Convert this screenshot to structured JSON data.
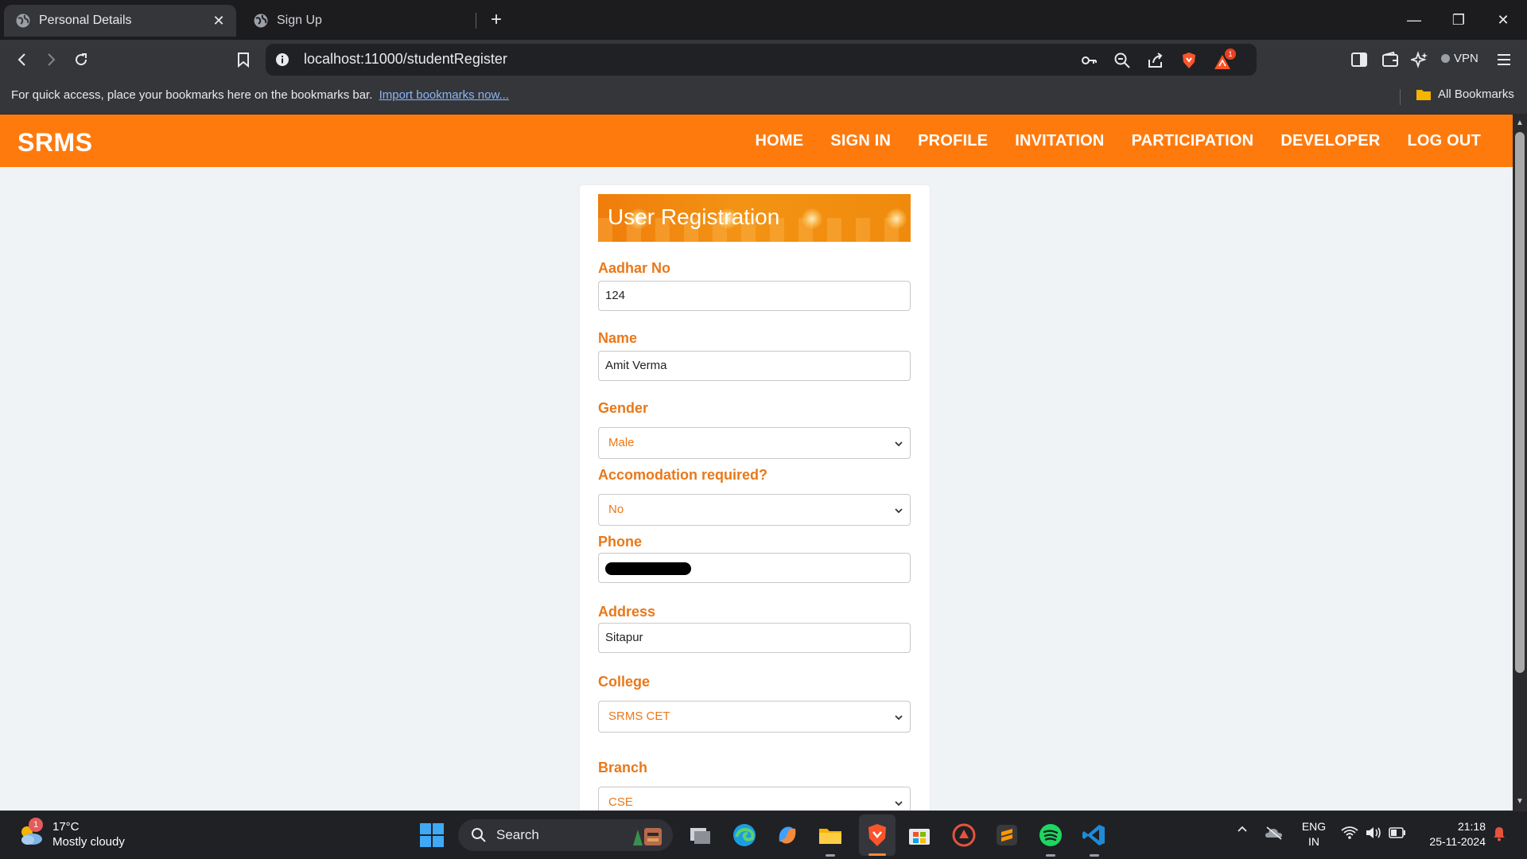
{
  "browser": {
    "tabs": [
      {
        "title": "Personal Details",
        "active": true
      },
      {
        "title": "Sign Up",
        "active": false
      }
    ],
    "url": "localhost:11000/studentRegister",
    "vpn_label": "VPN",
    "notification_count": "1",
    "bookmarks_bar": {
      "message": "For quick access, place your bookmarks here on the bookmarks bar.",
      "import_link": "Import bookmarks now...",
      "all_bookmarks": "All Bookmarks"
    }
  },
  "site": {
    "brand": "SRMS",
    "nav": [
      "HOME",
      "SIGN IN",
      "PROFILE",
      "INVITATION",
      "PARTICIPATION",
      "DEVELOPER",
      "LOG OUT"
    ],
    "accent_color": "#ff7a0d",
    "label_color": "#e9781a"
  },
  "form": {
    "title": "User Registration",
    "aadhar_label": "Aadhar No",
    "aadhar_value": "124",
    "name_label": "Name",
    "name_value": "Amit Verma",
    "gender_label": "Gender",
    "gender_value": "Male",
    "accommodation_label": "Accomodation required?",
    "accommodation_value": "No",
    "phone_label": "Phone",
    "address_label": "Address",
    "address_value": "Sitapur",
    "college_label": "College",
    "college_value": "SRMS CET",
    "branch_label": "Branch",
    "branch_value": "CSE"
  },
  "taskbar": {
    "weather_temp": "17°C",
    "weather_desc": "Mostly cloudy",
    "weather_badge": "1",
    "search_label": "Search",
    "lang_line1": "ENG",
    "lang_line2": "IN",
    "time": "21:18",
    "date": "25-11-2024"
  }
}
